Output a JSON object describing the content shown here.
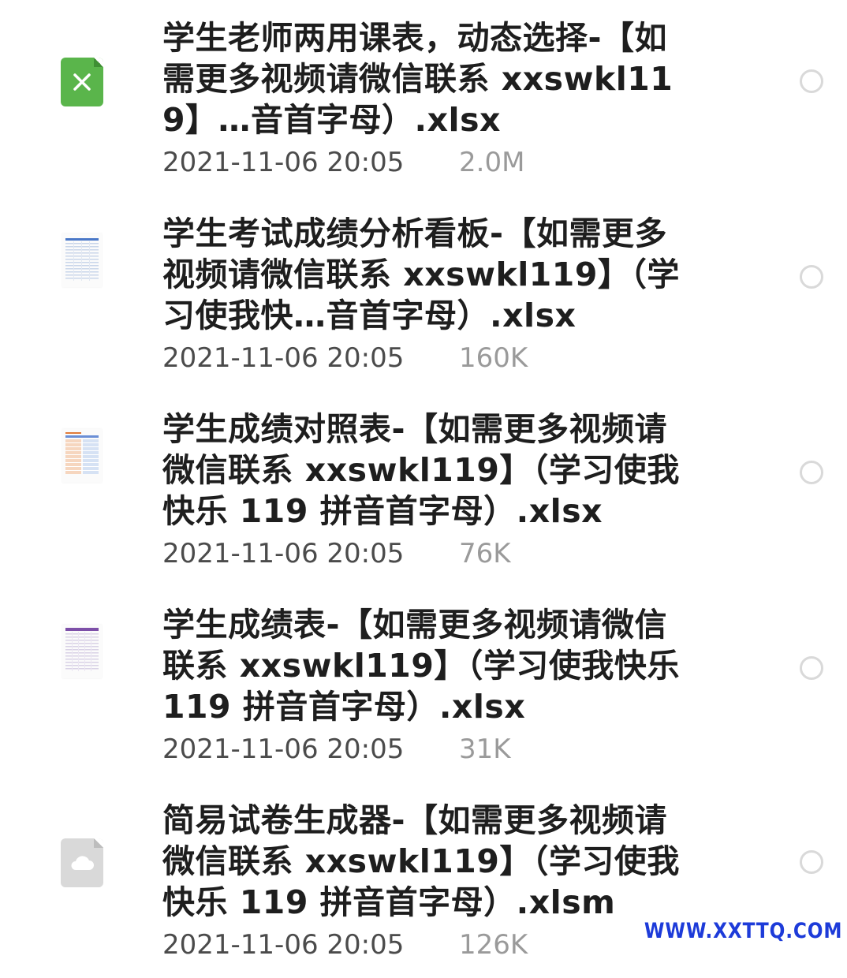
{
  "files": [
    {
      "name": "学生老师两用课表，动态选择-【如需更多视频请微信联系 xxswkl119】…音首字母）.xlsx",
      "date": "2021-11-06 20:05",
      "size": "2.0M",
      "icon": "excel-icon"
    },
    {
      "name": "学生考试成绩分析看板-【如需更多视频请微信联系 xxswkl119】（学习使我快…音首字母）.xlsx",
      "date": "2021-11-06 20:05",
      "size": "160K",
      "icon": "spreadsheet-thumbnail"
    },
    {
      "name": "学生成绩对照表-【如需更多视频请微信联系 xxswkl119】（学习使我快乐 119 拼音首字母）.xlsx",
      "date": "2021-11-06 20:05",
      "size": "76K",
      "icon": "spreadsheet-thumbnail"
    },
    {
      "name": "学生成绩表-【如需更多视频请微信联系 xxswkl119】（学习使我快乐 119 拼音首字母）.xlsx",
      "date": "2021-11-06 20:05",
      "size": "31K",
      "icon": "spreadsheet-thumbnail"
    },
    {
      "name": "简易试卷生成器-【如需更多视频请微信联系 xxswkl119】（学习使我快乐 119 拼音首字母）.xlsm",
      "date": "2021-11-06 20:05",
      "size": "126K",
      "icon": "cloud-file-icon"
    }
  ],
  "watermark": "WWW.XXTTQ.COM",
  "colors": {
    "excel_green": "#5ab54b",
    "watermark_blue": "#1d3bd9",
    "radio_border": "#d9d9d9"
  }
}
